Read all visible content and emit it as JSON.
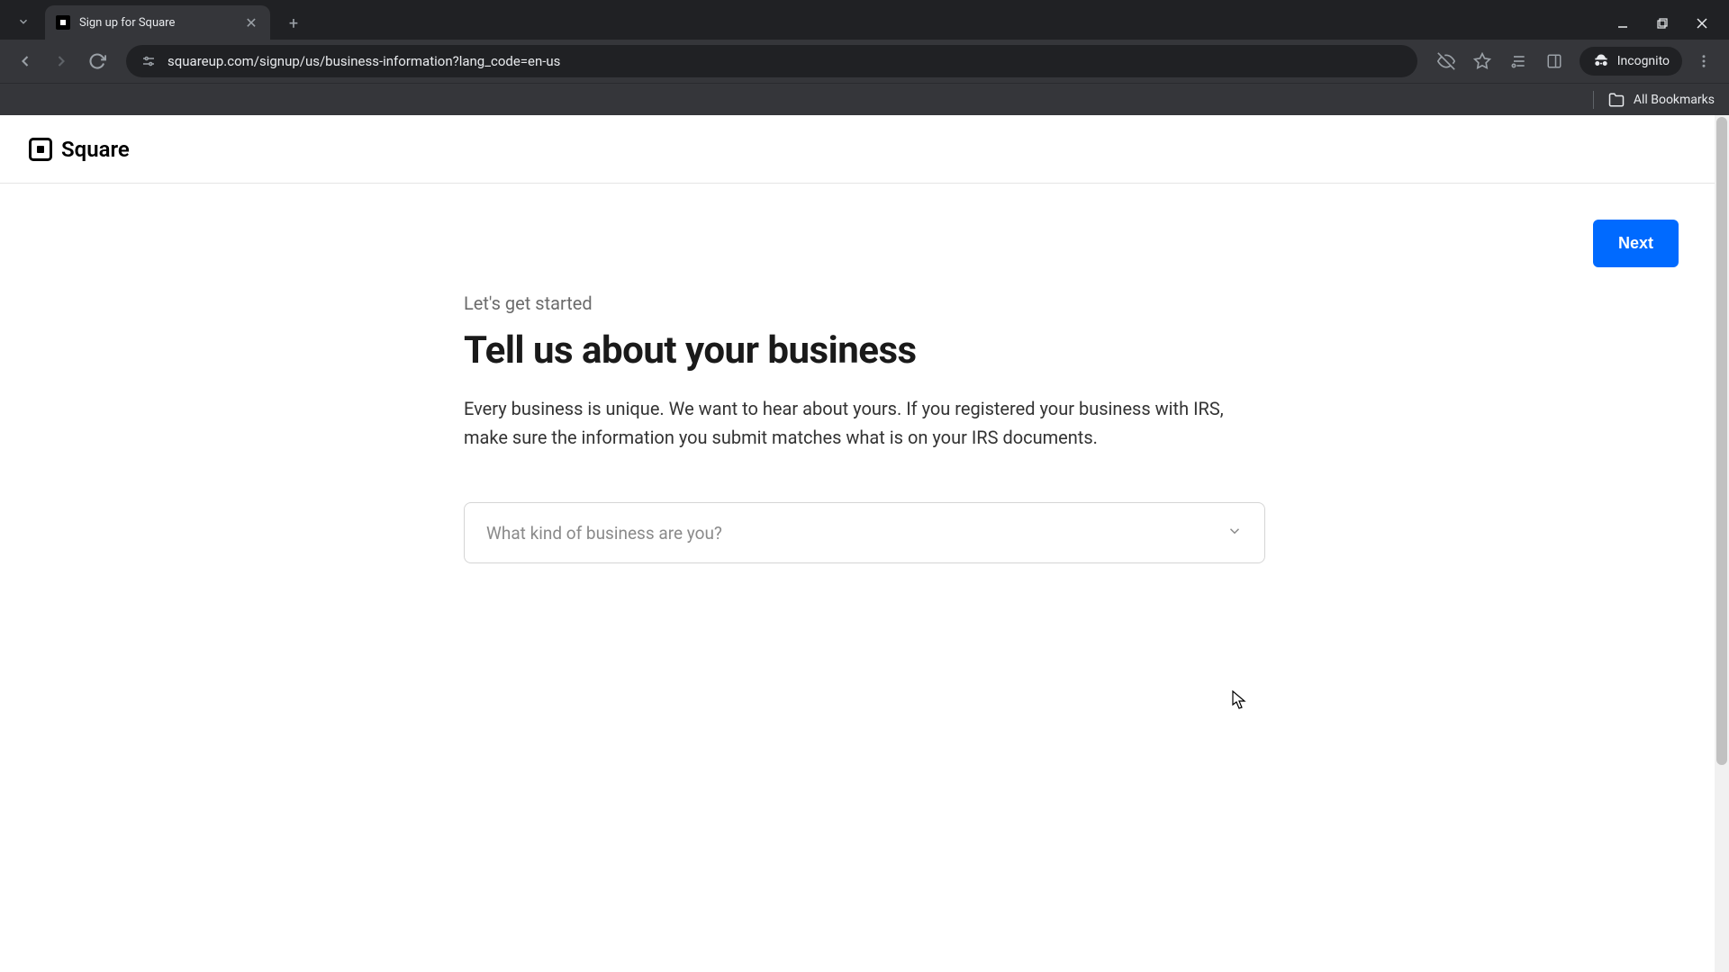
{
  "browser": {
    "tab_title": "Sign up for Square",
    "url": "squareup.com/signup/us/business-information?lang_code=en-us",
    "incognito_label": "Incognito",
    "bookmarks_label": "All Bookmarks"
  },
  "header": {
    "logo_text": "Square"
  },
  "actions": {
    "next_label": "Next"
  },
  "form": {
    "eyebrow": "Let's get started",
    "title": "Tell us about your business",
    "description": "Every business is unique. We want to hear about yours. If you registered your business with IRS, make sure the information you submit matches what is on your IRS documents.",
    "select_placeholder": "What kind of business are you?"
  }
}
